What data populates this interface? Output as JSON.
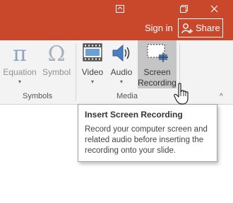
{
  "window": {
    "save_icon": "window-icon",
    "restore_icon": "restore-icon",
    "close_icon": "close-icon"
  },
  "account": {
    "signin_label": "Sign in",
    "share_label": "Share"
  },
  "ribbon": {
    "buttons": [
      {
        "label": "Equation",
        "icon": "equation-icon"
      },
      {
        "label": "Symbol",
        "icon": "symbol-icon"
      },
      {
        "label": "Video",
        "icon": "video-icon"
      },
      {
        "label": "Audio",
        "icon": "audio-icon"
      },
      {
        "label_line1": "Screen",
        "label_line2": "Recording",
        "icon": "screen-recording-icon"
      }
    ],
    "groups": {
      "symbols": "Symbols",
      "media": "Media"
    },
    "equation_glyph": "π",
    "symbol_glyph": "Ω"
  },
  "tooltip": {
    "title": "Insert Screen Recording",
    "body": "Record your computer screen and related audio before inserting the recording onto your slide."
  },
  "colors": {
    "title_bar": "#c9472b",
    "ribbon_bg": "#f3f3f3",
    "active_button": "#c5c5c5"
  }
}
